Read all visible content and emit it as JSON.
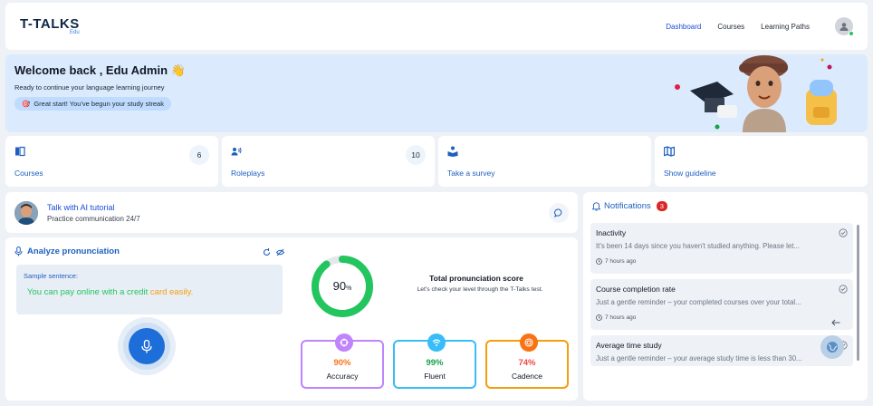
{
  "header": {
    "logo": "T-TALKS",
    "logo_sub": "Edu",
    "nav": [
      "Dashboard",
      "Courses",
      "Learning Paths"
    ]
  },
  "welcome": {
    "title": "Welcome back , Edu Admin 👋",
    "subtitle": "Ready to continue your language learning journey",
    "streak": "Great start! You've begun your study streak",
    "streak_icon": "🎯"
  },
  "cards": [
    {
      "label": "Courses",
      "count": "6",
      "icon": "book-icon"
    },
    {
      "label": "Roleplays",
      "count": "10",
      "icon": "users-icon"
    },
    {
      "label": "Take a survey",
      "count": "",
      "icon": "survey-icon"
    },
    {
      "label": "Show guideline",
      "count": "",
      "icon": "map-icon"
    }
  ],
  "tutorial": {
    "title": "Talk with AI tutorial",
    "subtitle": "Practice communication 24/7"
  },
  "analyze": {
    "title": "Analyze pronunciation",
    "sentence_label": "Sample sentence:",
    "sentence_green": "You can pay online with a credit ",
    "sentence_orange": "card easily.",
    "score": "90",
    "score_unit": "%",
    "score_fraction": 0.9,
    "score_title": "Total pronunciation score",
    "score_sub": "Let's check your level through the T-Talks test.",
    "metrics": [
      {
        "value": "90%",
        "label": "Accuracy",
        "color": "#f97316",
        "border": "#c084fc"
      },
      {
        "value": "99%",
        "label": "Fluent",
        "color": "#16a34a",
        "border": "#38bdf8"
      },
      {
        "value": "74%",
        "label": "Cadence",
        "color": "#ef4444",
        "border": "#f59e0b"
      }
    ]
  },
  "notifications": {
    "title": "Notifications",
    "count": "3",
    "items": [
      {
        "title": "Inactivity",
        "message": "It's been 14 days since you haven't studied anything. Please let...",
        "time": "7 hours ago"
      },
      {
        "title": "Course completion rate",
        "message": "Just a gentle reminder – your completed courses over your total...",
        "time": "7 hours ago"
      },
      {
        "title": "Average time study",
        "message": "Just a gentle reminder – your average study time is less than 30...",
        "time": ""
      }
    ]
  }
}
